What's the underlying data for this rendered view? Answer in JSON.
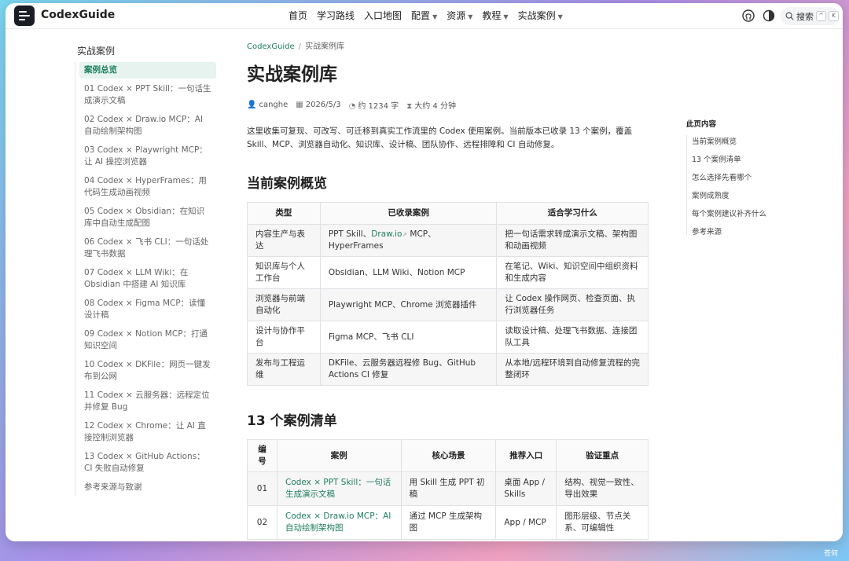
{
  "site": {
    "name": "CodexGuide"
  },
  "nav": {
    "links": [
      {
        "label": "首页",
        "caret": false
      },
      {
        "label": "学习路线",
        "caret": false
      },
      {
        "label": "入口地图",
        "caret": false
      },
      {
        "label": "配置",
        "caret": true
      },
      {
        "label": "资源",
        "caret": true
      },
      {
        "label": "教程",
        "caret": true
      },
      {
        "label": "实战案例",
        "caret": true
      }
    ],
    "icons": [
      "github-icon",
      "contrast-icon"
    ],
    "search_label": "搜索",
    "search_keys": [
      "^",
      "K"
    ]
  },
  "sidebar": {
    "title": "实战案例",
    "items": [
      "案例总览",
      "01 Codex × PPT Skill：一句话生成演示文稿",
      "02 Codex × Draw.io MCP：AI 自动绘制架构图",
      "03 Codex × Playwright MCP：让 AI 操控浏览器",
      "04 Codex × HyperFrames：用代码生成动画视频",
      "05 Codex × Obsidian：在知识库中自动生成配图",
      "06 Codex × 飞书 CLI：一句话处理飞书数据",
      "07 Codex × LLM Wiki：在 Obsidian 中搭建 AI 知识库",
      "08 Codex × Figma MCP：读懂设计稿",
      "09 Codex × Notion MCP：打通知识空间",
      "10 Codex × DKFile：网页一键发布到公网",
      "11 Codex × 云服务器：远程定位并修复 Bug",
      "12 Codex × Chrome：让 AI 直接控制浏览器",
      "13 Codex × GitHub Actions：CI 失败自动修复",
      "参考来源与致谢"
    ]
  },
  "breadcrumb": {
    "home": "CodexGuide",
    "sep": "/",
    "current": "实战案例库"
  },
  "page": {
    "title": "实战案例库",
    "meta": {
      "author": "canghe",
      "date": "2026/5/3",
      "words": "约 1234 字",
      "read_time": "大约 4 分钟"
    },
    "intro": "这里收集可复现、可改写、可迁移到真实工作流里的 Codex 使用案例。当前版本已收录 13 个案例，覆盖 Skill、MCP、浏览器自动化、知识库、设计稿、团队协作、远程排障和 CI 自动修复。",
    "section1": "当前案例概览",
    "section2": "13 个案例清单"
  },
  "table1": {
    "headers": [
      "类型",
      "已收录案例",
      "适合学习什么"
    ],
    "rows": [
      [
        "内容生产与表达",
        "PPT Skill、Draw.io ↗ MCP、HyperFrames",
        "把一句话需求转成演示文稿、架构图和动画视频"
      ],
      [
        "知识库与个人工作台",
        "Obsidian、LLM Wiki、Notion MCP",
        "在笔记、Wiki、知识空间中组织资料和生成内容"
      ],
      [
        "浏览器与前端自动化",
        "Playwright MCP、Chrome 浏览器插件",
        "让 Codex 操作网页、检查页面、执行浏览器任务"
      ],
      [
        "设计与协作平台",
        "Figma MCP、飞书 CLI",
        "读取设计稿、处理飞书数据、连接团队工具"
      ],
      [
        "发布与工程运维",
        "DKFile、云服务器远程修 Bug、GitHub Actions CI 修复",
        "从本地/远程环境到自动修复流程的完整闭环"
      ]
    ]
  },
  "table1_row1_case": {
    "pre": "PPT Skill、",
    "link": "Draw.io",
    "ext": "↗",
    "post": " MCP、HyperFrames"
  },
  "table2": {
    "headers": [
      "编号",
      "案例",
      "核心场景",
      "推荐入口",
      "验证重点"
    ],
    "rows": [
      [
        "01",
        "Codex × PPT Skill：一句话生成演示文稿",
        "用 Skill 生成 PPT 初稿",
        "桌面 App / Skills",
        "结构、视觉一致性、导出效果"
      ],
      [
        "02",
        "Codex × Draw.io MCP：AI 自动绘制架构图",
        "通过 MCP 生成架构图",
        "App / MCP",
        "图形层级、节点关系、可编辑性"
      ]
    ]
  },
  "toc": {
    "title": "此页内容",
    "items": [
      "当前案例概览",
      "13 个案例清单",
      "怎么选择先看哪个",
      "案例成熟度",
      "每个案例建议补齐什么",
      "参考来源"
    ]
  },
  "watermark": "苍何",
  "colors": {
    "accent": "#1e7d5e",
    "active_bg": "#e6f3ef"
  }
}
